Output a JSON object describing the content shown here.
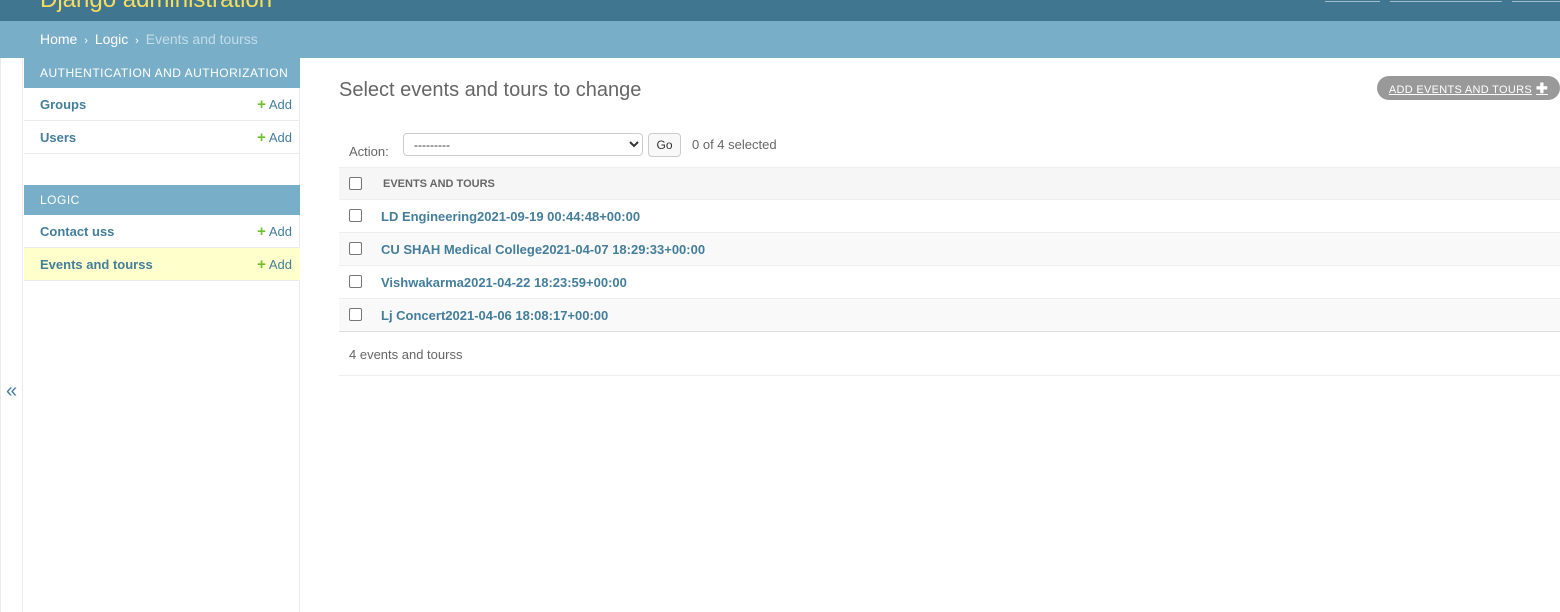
{
  "header": {
    "branding": "Django administration"
  },
  "breadcrumbs": {
    "home": "Home",
    "sep": "›",
    "app": "Logic",
    "current": "Events and tourss"
  },
  "sidebar": {
    "toggle": "«",
    "modules": [
      {
        "caption": "Authentication and Authorization",
        "rows": [
          {
            "name": "Groups",
            "add": "Add"
          },
          {
            "name": "Users",
            "add": "Add"
          }
        ]
      },
      {
        "caption": "Logic",
        "rows": [
          {
            "name": "Contact uss",
            "add": "Add"
          },
          {
            "name": "Events and tourss",
            "add": "Add"
          }
        ]
      }
    ]
  },
  "content": {
    "title": "Select events and tours to change",
    "add_button": "Add Events and Tours",
    "actions": {
      "label": "Action:",
      "selected_option": "---------",
      "go": "Go",
      "counter": "0 of 4 selected"
    },
    "table": {
      "column": "Events and Tours",
      "rows": [
        "LD Engineering2021-09-19 00:44:48+00:00",
        "CU SHAH Medical College2021-04-07 18:29:33+00:00",
        "Vishwakarma2021-04-22 18:23:59+00:00",
        "Lj Concert2021-04-06 18:08:17+00:00"
      ]
    },
    "paginator": "4 events and tourss"
  },
  "colors": {
    "header": "#417690",
    "breadcrumbs": "#79aec8",
    "branding": "#f5dd5d",
    "link": "#447e9b",
    "add_plus": "#70bf2b",
    "current_row": "#ffffcc"
  }
}
